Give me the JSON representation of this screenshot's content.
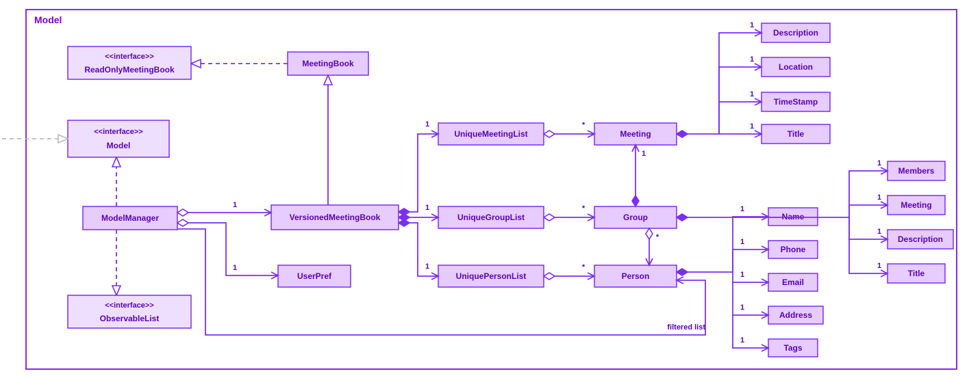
{
  "frame_title": "Model",
  "boxes": {
    "readOnlyMeetingBook": {
      "stereotype": "<<interface>>",
      "name": "ReadOnlyMeetingBook"
    },
    "modelIface": {
      "stereotype": "<<interface>>",
      "name": "Model"
    },
    "observableList": {
      "stereotype": "<<interface>>",
      "name": "ObservableList"
    },
    "meetingBook": {
      "name": "MeetingBook"
    },
    "modelManager": {
      "name": "ModelManager"
    },
    "versionedMeetingBook": {
      "name": "VersionedMeetingBook"
    },
    "userPref": {
      "name": "UserPref"
    },
    "uniqueMeetingList": {
      "name": "UniqueMeetingList"
    },
    "uniqueGroupList": {
      "name": "UniqueGroupList"
    },
    "uniquePersonList": {
      "name": "UniquePersonList"
    },
    "meeting": {
      "name": "Meeting"
    },
    "group": {
      "name": "Group"
    },
    "person": {
      "name": "Person"
    },
    "description": {
      "name": "Description"
    },
    "location": {
      "name": "Location"
    },
    "timeStamp": {
      "name": "TimeStamp"
    },
    "titleM": {
      "name": "Title"
    },
    "members": {
      "name": "Members"
    },
    "meetingG": {
      "name": "Meeting"
    },
    "descriptionG": {
      "name": "Description"
    },
    "titleG": {
      "name": "Title"
    },
    "name": {
      "name": "Name"
    },
    "phone": {
      "name": "Phone"
    },
    "email": {
      "name": "Email"
    },
    "address": {
      "name": "Address"
    },
    "tags": {
      "name": "Tags"
    }
  },
  "mults": {
    "one": "1",
    "star": "*"
  },
  "filtered_label": "filtered list"
}
